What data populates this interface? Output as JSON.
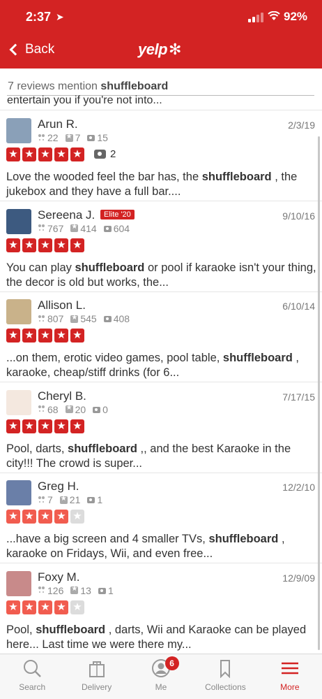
{
  "status_bar": {
    "time": "2:37",
    "battery": "92%"
  },
  "nav": {
    "back_label": "Back",
    "logo_text": "yelp"
  },
  "mentions": {
    "prefix": "7 reviews mention",
    "keyword": "shuffleboard",
    "cut_text": "entertain you if you're not into..."
  },
  "reviews": [
    {
      "name": "Arun R.",
      "date": "2/3/19",
      "friends": "22",
      "reviews": "7",
      "photos": "15",
      "rating": 5,
      "photo_count": "2",
      "snippet_parts": [
        "Love the wooded feel the bar has, the ",
        "shuffleboard",
        " , the jukebox and they have a full bar...."
      ]
    },
    {
      "name": "Sereena J.",
      "elite": "Elite '20",
      "date": "9/10/16",
      "friends": "767",
      "reviews": "414",
      "photos": "604",
      "rating": 5,
      "snippet_parts": [
        "You can play ",
        "shuffleboard",
        " or pool if karaoke isn't your thing, the decor is old but works, the..."
      ]
    },
    {
      "name": "Allison L.",
      "date": "6/10/14",
      "friends": "807",
      "reviews": "545",
      "photos": "408",
      "rating": 5,
      "snippet_parts": [
        "...on them, erotic video games, pool table, ",
        "shuffleboard",
        " , karaoke, cheap/stiff drinks (for 6..."
      ]
    },
    {
      "name": "Cheryl B.",
      "date": "7/17/15",
      "friends": "68",
      "reviews": "20",
      "photos": "0",
      "rating": 5,
      "snippet_parts": [
        "Pool, darts, ",
        "shuffleboard",
        " ,, and the best Karaoke in the city!!! The crowd is super..."
      ]
    },
    {
      "name": "Greg H.",
      "date": "12/2/10",
      "friends": "7",
      "reviews": "21",
      "photos": "1",
      "rating": 4,
      "snippet_parts": [
        "...have a big screen and 4 smaller TVs, ",
        "shuffleboard",
        " , karaoke on Fridays, Wii, and even free..."
      ]
    },
    {
      "name": "Foxy M.",
      "date": "12/9/09",
      "friends": "126",
      "reviews": "13",
      "photos": "1",
      "rating": 4,
      "snippet_parts": [
        "Pool, ",
        "shuffleboard",
        " , darts, Wii and Karaoke can be played here... Last time we were there my..."
      ]
    }
  ],
  "tabs": [
    {
      "label": "Search",
      "icon": "search-icon"
    },
    {
      "label": "Delivery",
      "icon": "delivery-bag-icon"
    },
    {
      "label": "Me",
      "icon": "profile-icon",
      "badge": "6"
    },
    {
      "label": "Collections",
      "icon": "bookmark-icon"
    },
    {
      "label": "More",
      "icon": "menu-icon",
      "active": true
    }
  ],
  "colors": {
    "brand": "#d32323",
    "four_star": "#f15c4f"
  }
}
